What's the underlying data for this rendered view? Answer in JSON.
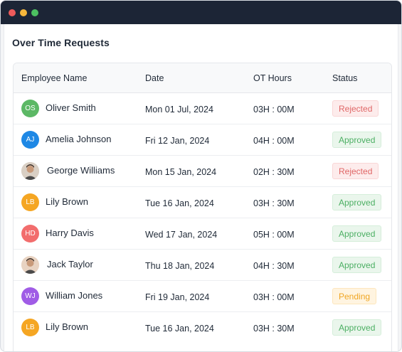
{
  "title": "Over Time Requests",
  "columns": [
    "Employee Name",
    "Date",
    "OT Hours",
    "Status"
  ],
  "rows": [
    {
      "initials": "OS",
      "name": "Oliver Smith",
      "date": "Mon 01 Jul, 2024",
      "hours": "03H : 00M",
      "status": "Rejected",
      "avatar_color": "#5cb865",
      "photo": false
    },
    {
      "initials": "AJ",
      "name": "Amelia Johnson",
      "date": "Fri 12 Jan, 2024",
      "hours": "04H : 00M",
      "status": "Approved",
      "avatar_color": "#1e88e5",
      "photo": false
    },
    {
      "initials": "",
      "name": "George Williams",
      "date": "Mon 15 Jan, 2024",
      "hours": "02H : 30M",
      "status": "Rejected",
      "avatar_color": "#d9cfc4",
      "photo": true
    },
    {
      "initials": "LB",
      "name": "Lily Brown",
      "date": "Tue 16 Jan, 2024",
      "hours": "03H : 30M",
      "status": "Approved",
      "avatar_color": "#f5a623",
      "photo": false
    },
    {
      "initials": "HD",
      "name": "Harry Davis",
      "date": "Wed 17 Jan, 2024",
      "hours": "05H : 00M",
      "status": "Approved",
      "avatar_color": "#f26d6d",
      "photo": false
    },
    {
      "initials": "",
      "name": "Jack Taylor",
      "date": "Thu 18 Jan, 2024",
      "hours": "04H : 30M",
      "status": "Approved",
      "avatar_color": "#e8d3c2",
      "photo": true
    },
    {
      "initials": "WJ",
      "name": "William Jones",
      "date": "Fri 19 Jan, 2024",
      "hours": "03H : 00M",
      "status": "Pending",
      "avatar_color": "#a05ce6",
      "photo": false
    },
    {
      "initials": "LB",
      "name": "Lily Brown",
      "date": "Tue 16 Jan, 2024",
      "hours": "03H : 30M",
      "status": "Approved",
      "avatar_color": "#f5a623",
      "photo": false
    }
  ]
}
